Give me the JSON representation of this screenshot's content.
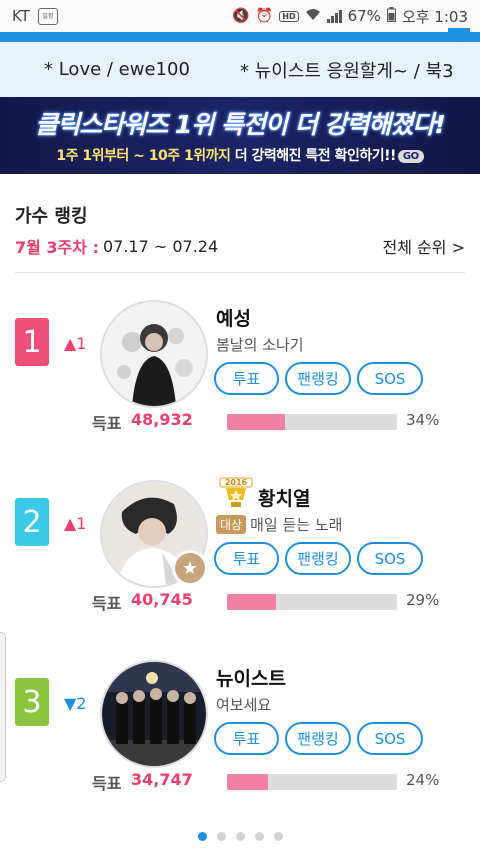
{
  "status_bar": {
    "carrier": "KT",
    "notification_text": "일정",
    "battery": "67%",
    "time": "오후 1:03"
  },
  "ticker": {
    "items": [
      "* Love / ewe100",
      "* 뉴이스트 응원할게~ / 북3"
    ]
  },
  "banner": {
    "title": "클릭스타워즈 1위 특전이 더 강력해졌다!",
    "sub_yellow": "1주 1위부터 ~ 10주 1위까지",
    "sub_white": " 더 강력해진 특전 확인하기!!",
    "go": "GO"
  },
  "ranking": {
    "title": "가수 랭킹",
    "week_label": "7월 3주차 :",
    "week_range": "07.17 ~ 07.24",
    "see_all": "전체 순위 >",
    "vote_label": "득표",
    "buttons": {
      "vote": "투표",
      "fanranking": "팬랭킹",
      "sos": "SOS"
    },
    "entries": [
      {
        "rank": "1",
        "change": "▲1",
        "direction": "up",
        "color": "#ef4f78",
        "name": "예성",
        "song": "봄날의 소나기",
        "badge": "",
        "trophy_year": "",
        "votes": "48,932",
        "percent": "34%",
        "fill": 0.34
      },
      {
        "rank": "2",
        "change": "▲1",
        "direction": "up",
        "color": "#3cc8e8",
        "name": "황치열",
        "song": "매일 듣는 노래",
        "badge": "대상",
        "trophy_year": "2016",
        "votes": "40,745",
        "percent": "29%",
        "fill": 0.29
      },
      {
        "rank": "3",
        "change": "▼2",
        "direction": "down",
        "color": "#8cc63f",
        "name": "뉴이스트",
        "song": "여보세요",
        "badge": "",
        "trophy_year": "",
        "votes": "34,747",
        "percent": "24%",
        "fill": 0.24
      }
    ]
  },
  "pagination": {
    "count": 5,
    "active": 0
  }
}
